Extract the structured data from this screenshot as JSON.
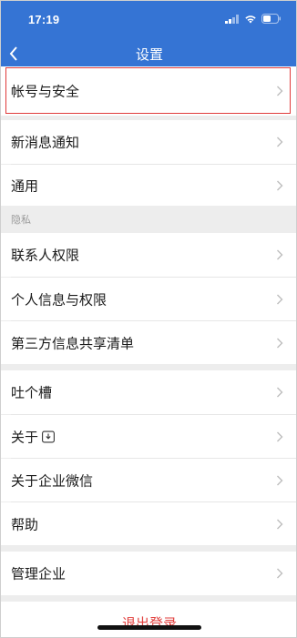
{
  "status_bar": {
    "time": "17:19",
    "icons": [
      "signal-icon",
      "wifi-icon",
      "battery-icon"
    ]
  },
  "nav": {
    "title": "设置",
    "back_icon": "chevron-left-icon"
  },
  "colors": {
    "header": "#3574d4",
    "highlight": "#e03a3a",
    "logout": "#e2413f"
  },
  "groups": {
    "account": {
      "label": "帐号与安全"
    },
    "general": [
      {
        "label": "新消息通知"
      },
      {
        "label": "通用"
      }
    ],
    "privacy_title": "隐私",
    "privacy": [
      {
        "label": "联系人权限"
      },
      {
        "label": "个人信息与权限"
      },
      {
        "label": "第三方信息共享清单"
      }
    ],
    "misc": [
      {
        "label": "吐个槽"
      },
      {
        "label": "关于"
      },
      {
        "label": "关于企业微信"
      },
      {
        "label": "帮助"
      }
    ],
    "manage": {
      "label": "管理企业"
    }
  },
  "logout": {
    "label": "退出登录"
  }
}
